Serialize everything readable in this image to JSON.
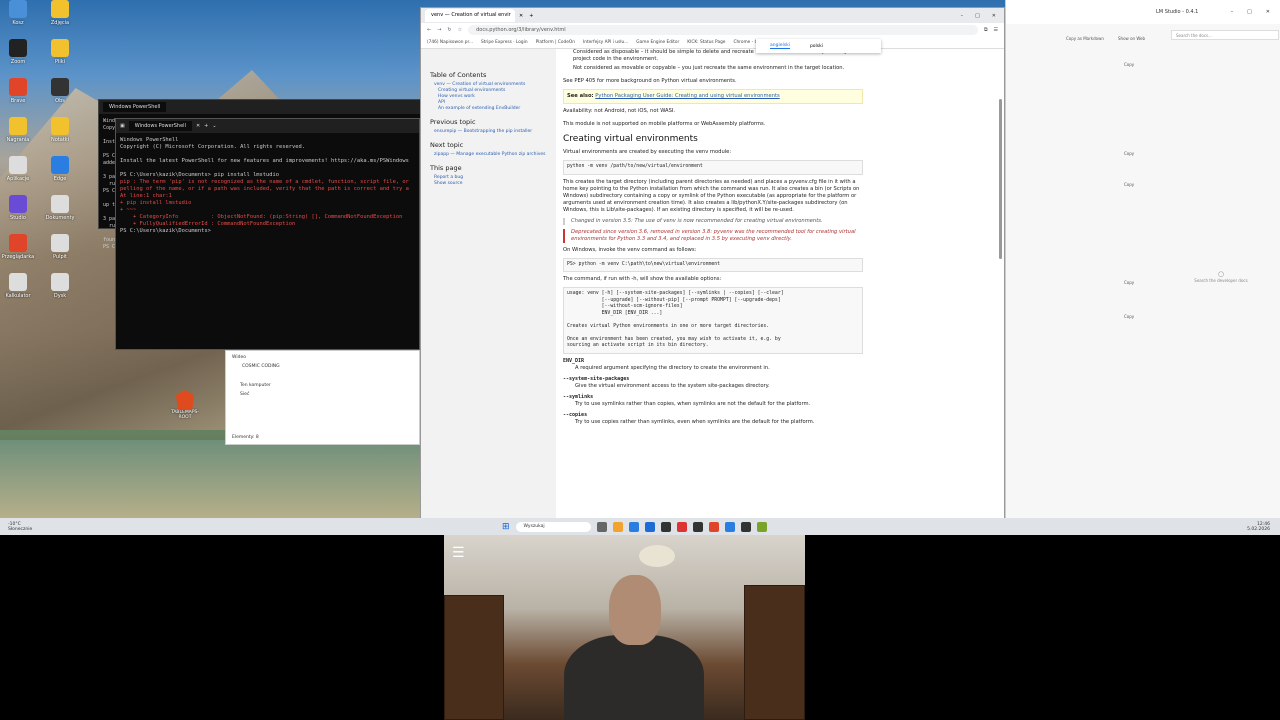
{
  "desktop": {
    "icons": [
      "Kosz",
      "Zdjęcia",
      "Zoom",
      "Pliki",
      "Brave",
      "Obs",
      "Nagrania",
      "Notatki",
      "Aplikacje",
      "Edge",
      "Studio",
      "Dokumenty",
      "Przeglądarka",
      "Pulpit",
      "Kalkulator",
      "Dysk"
    ],
    "shortcut_label": "TABLEMAPS-ROOT"
  },
  "terminal_back": {
    "title": "Windows PowerShell",
    "lines": [
      "Windo",
      "Copyr",
      "",
      "Insta",
      "",
      "PS C:",
      "added",
      "",
      "3 pac",
      "  run",
      "PS C:",
      "",
      "up to",
      "",
      "3 pac",
      "  run",
      "",
      "found",
      "PS C:"
    ]
  },
  "terminal": {
    "title": "Windows PowerShell",
    "lines": [
      "Windows PowerShell",
      "Copyright (C) Microsoft Corporation. All rights reserved.",
      "",
      "Install the latest PowerShell for new features and improvements! https://aka.ms/PSWindows",
      "",
      "PS C:\\Users\\kazik\\Documents> pip install lmstudio"
    ],
    "error_lines": [
      "pip : The term 'pip' is not recognized as the name of a cmdlet, function, script file, or",
      "pelling of the name, or if a path was included, verify that the path is correct and try a",
      "At line:1 char:1",
      "+ pip install lmstudio",
      "+ ~~~",
      "    + CategoryInfo          : ObjectNotFound: (pip:String) [], CommandNotFoundException",
      "    + FullyQualifiedErrorId : CommandNotFoundException"
    ],
    "prompt": "PS C:\\Users\\kazik\\Documents> "
  },
  "explorer": {
    "items": [
      "Wideo",
      "COSMIC CODING",
      "Ten komputer",
      "Sieć"
    ],
    "status": "Elementy: 8"
  },
  "browser": {
    "tab_title": "venv — Creation of virtual envir",
    "url": "docs.python.org/3/library/venv.html",
    "bookmarks": [
      "(746) Napisowon pr...",
      "Stripe Express · Login",
      "Platform | CodeOn",
      "Interfejsy API i usłu...",
      "Game Engine Editor",
      "KICK: Status Page",
      "Chrome - OpenAI",
      "Dispatch PLM ze An..."
    ],
    "lang_popup": [
      "angielski",
      "polski"
    ],
    "sidebar": {
      "toc_title": "Table of Contents",
      "toc": [
        "venv — Creation of virtual environments",
        "Creating virtual environments",
        "How venvs work",
        "API",
        "An example of extending EnvBuilder"
      ],
      "prev_title": "Previous topic",
      "prev": "ensurepip — Bootstrapping the pip installer",
      "next_title": "Next topic",
      "next": "zipapp — Manage executable Python zip archives",
      "this_page": "This page",
      "this_page_links": [
        "Report a bug",
        "Show source"
      ]
    },
    "content": {
      "bullets": [
        "Considered as disposable – it should be simple to delete and recreate it from scratch. You don't place any project code in the environment.",
        "Not considered as movable or copyable – you just recreate the same environment in the target location."
      ],
      "see_pep": "See PEP 405 for more background on Python virtual environments.",
      "see_also_label": "See also:",
      "see_also_link": "Python Packaging User Guide: Creating and using virtual environments",
      "availability": "Availability: not Android, not iOS, not WASI.",
      "not_supported": "This module is not supported on mobile platforms or WebAssembly platforms.",
      "heading": "Creating virtual environments",
      "created_by": "Virtual environments are created by executing the venv module:",
      "code1": "python -m venv /path/to/new/virtual/environment",
      "para1": "This creates the target directory (including parent directories as needed) and places a pyvenv.cfg file in it with a home key pointing to the Python installation from which the command was run. It also creates a bin (or Scripts on Windows) subdirectory containing a copy or symlink of the Python executable (as appropriate for the platform or arguments used at environment creation time). It also creates a lib/pythonX.Y/site-packages subdirectory (on Windows, this is Lib\\site-packages). If an existing directory is specified, it will be re-used.",
      "changed": "Changed in version 3.5: The use of venv is now recommended for creating virtual environments.",
      "deprecated": "Deprecated since version 3.6, removed in version 3.8: pyvenv was the recommended tool for creating virtual environments for Python 3.3 and 3.4, and replaced in 3.5 by executing venv directly.",
      "windows_invoke": "On Windows, invoke the venv command as follows:",
      "code2": "PS> python -m venv C:\\path\\to\\new\\virtual\\environment",
      "run_with_h": "The command, if run with -h, will show the available options:",
      "code3": "usage: venv [-h] [--system-site-packages] [--symlinks | --copies] [--clear]\n            [--upgrade] [--without-pip] [--prompt PROMPT] [--upgrade-deps]\n            [--without-scm-ignore-files]\n            ENV_DIR [ENV_DIR ...]\n\nCreates virtual Python environments in one or more target directories.\n\nOnce an environment has been created, you may wish to activate it, e.g. by\nsourcing an activate script in its bin directory.",
      "options": [
        {
          "name": "ENV_DIR",
          "desc": "A required argument specifying the directory to create the environment in."
        },
        {
          "name": "--system-site-packages",
          "desc": "Give the virtual environment access to the system site-packages directory."
        },
        {
          "name": "--symlinks",
          "desc": "Try to use symlinks rather than copies, when symlinks are not the default for the platform."
        },
        {
          "name": "--copies",
          "desc": "Try to use copies rather than symlinks, even when symlinks are the default for the platform."
        }
      ]
    }
  },
  "right_app": {
    "title": "LM Studio - 0.4.1",
    "copy_markdown": "Copy as Markdown",
    "show_web": "Show on Web",
    "search_placeholder": "Search the docs...",
    "copy_label": "Copy",
    "empty_text": "Search the developer docs"
  },
  "taskbar": {
    "weather_temp": "-10°C",
    "weather_desc": "Słonecznie",
    "search_placeholder": "Wyszukaj",
    "time": "12:46",
    "date": "5.02.2026"
  }
}
